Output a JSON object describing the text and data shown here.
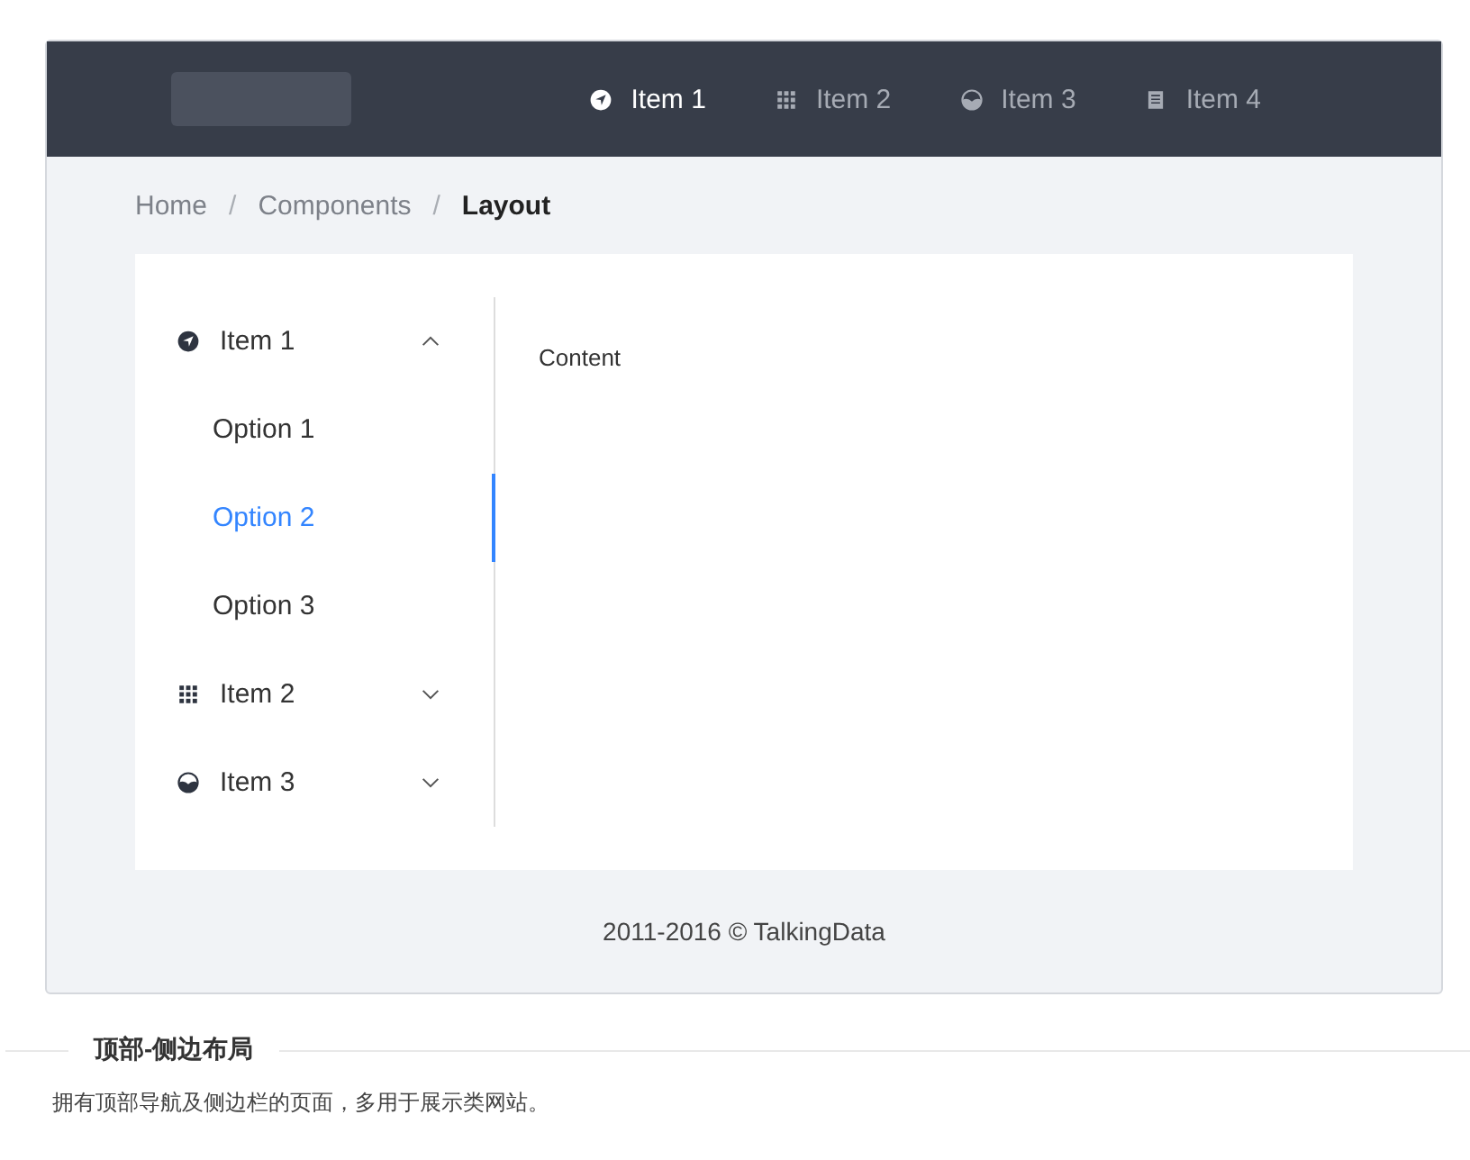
{
  "header": {
    "nav": [
      {
        "label": "Item 1",
        "selected": true
      },
      {
        "label": "Item 2",
        "selected": false
      },
      {
        "label": "Item 3",
        "selected": false
      },
      {
        "label": "Item 4",
        "selected": false
      }
    ]
  },
  "breadcrumb": [
    {
      "label": "Home",
      "selected": false
    },
    {
      "label": "Components",
      "selected": false
    },
    {
      "label": "Layout",
      "selected": true
    }
  ],
  "breadcrumb_separator": "/",
  "sidebar": {
    "items": [
      {
        "label": "Item 1",
        "expanded": true,
        "children": [
          {
            "label": "Option 1",
            "selected": false
          },
          {
            "label": "Option 2",
            "selected": true
          },
          {
            "label": "Option 3",
            "selected": false
          }
        ]
      },
      {
        "label": "Item 2",
        "expanded": false
      },
      {
        "label": "Item 3",
        "expanded": false
      }
    ]
  },
  "content": "Content",
  "footer": "2011-2016 © TalkingData",
  "demo": {
    "title": "顶部-侧边布局",
    "description": "拥有顶部导航及侧边栏的页面，多用于展示类网站。"
  }
}
